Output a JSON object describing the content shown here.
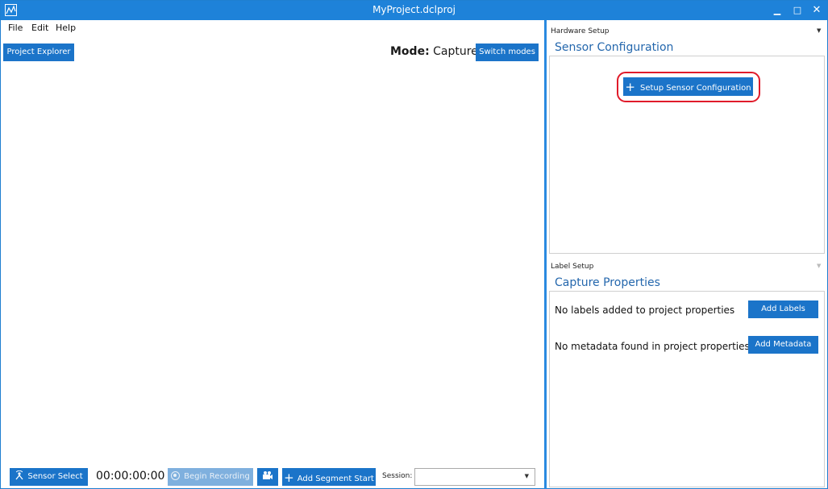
{
  "window": {
    "title": "MyProject.dclproj"
  },
  "menu": {
    "file": "File",
    "edit": "Edit",
    "help": "Help"
  },
  "toolbar": {
    "project_explorer": "Project Explorer",
    "mode_label": "Mode:",
    "mode_value": "Capture",
    "switch_modes": "Switch modes"
  },
  "hardware_setup": {
    "header": "Hardware Setup",
    "title": "Sensor Configuration",
    "setup_button": "Setup Sensor Configuration"
  },
  "label_setup": {
    "header": "Label Setup",
    "title": "Capture Properties",
    "no_labels": "No labels added to project properties",
    "add_labels": "Add Labels",
    "no_metadata": "No metadata found in project properties",
    "add_metadata": "Add Metadata"
  },
  "bottom": {
    "sensor_select": "Sensor Select",
    "timer": "00:00:00:00",
    "begin_recording": "Begin Recording",
    "add_segment_start": "Add Segment Start",
    "session_label": "Session:",
    "session_value": ""
  },
  "icons": {
    "app": "chart-icon",
    "minimize": "minimize-icon",
    "maximize": "maximize-icon",
    "close": "close-icon",
    "plus": "plus-icon",
    "sensor": "sensor-icon",
    "record": "record-icon",
    "camera": "camera-icon",
    "dropdown": "chevron-down-icon"
  },
  "colors": {
    "accent": "#1b74c9",
    "titlebar": "#1e82d9",
    "panel_title": "#2467ad",
    "highlight": "#e01b2a",
    "disabled_button": "#7fb0de"
  }
}
